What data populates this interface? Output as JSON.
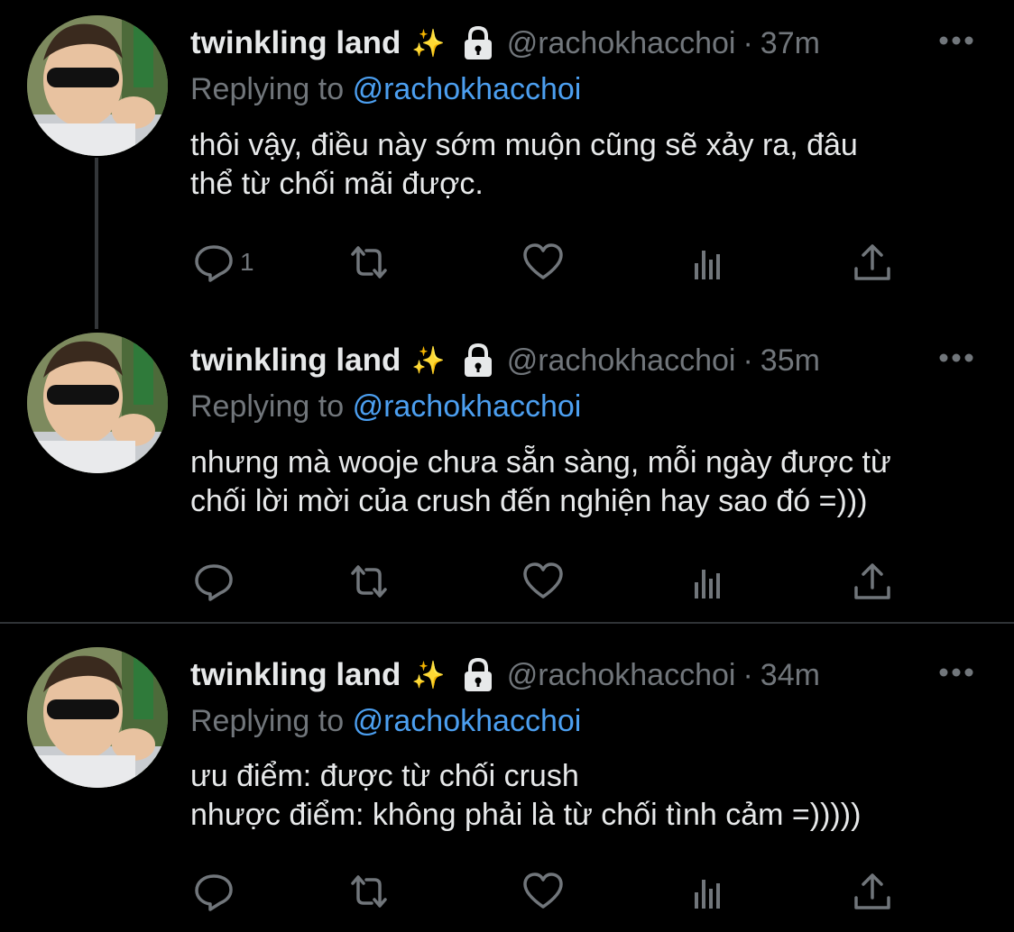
{
  "tweets": [
    {
      "author": {
        "name": "twinkling land",
        "emoji": "✨",
        "handle": "@rachokhacchoi",
        "protected": true,
        "avatar_icon": "avatar-child-sunglasses"
      },
      "separator": "·",
      "time": "37m",
      "replying_label": "Replying to",
      "replying_to": "@rachokhacchoi",
      "text": "thôi vậy, điều này sớm muộn cũng sẽ xảy ra, đâu\nthể từ chối mãi được.",
      "reply_count": "1"
    },
    {
      "author": {
        "name": "twinkling land",
        "emoji": "✨",
        "handle": "@rachokhacchoi",
        "protected": true,
        "avatar_icon": "avatar-child-sunglasses"
      },
      "separator": "·",
      "time": "35m",
      "replying_label": "Replying to",
      "replying_to": "@rachokhacchoi",
      "text": "nhưng mà wooje chưa sẵn sàng, mỗi ngày được từ\nchối lời mời của crush đến nghiện hay sao đó =)))",
      "reply_count": ""
    },
    {
      "author": {
        "name": "twinkling land",
        "emoji": "✨",
        "handle": "@rachokhacchoi",
        "protected": true,
        "avatar_icon": "avatar-child-sunglasses"
      },
      "separator": "·",
      "time": "34m",
      "replying_label": "Replying to",
      "replying_to": "@rachokhacchoi",
      "text": "ưu điểm: được từ chối crush\nnhược điểm: không phải là từ chối tình cảm =)))))",
      "reply_count": ""
    }
  ],
  "action_icons": [
    "reply-icon",
    "retweet-icon",
    "like-icon",
    "views-icon",
    "share-icon"
  ],
  "colors": {
    "background": "#000000",
    "text": "#e7e9ea",
    "muted": "#71767b",
    "mention": "#4c9ff0",
    "divider": "#2f3336"
  }
}
